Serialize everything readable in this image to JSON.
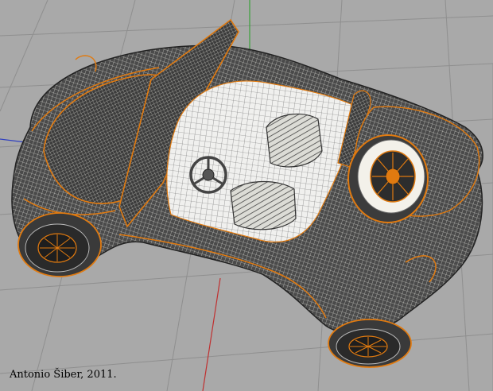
{
  "viewport": {
    "credit": "Antonio Šiber, 2011.",
    "background_color": "#a9a9a9",
    "grid_color": "#8f8f8f",
    "axes": [
      {
        "name": "x-axis",
        "color": "#c03030"
      },
      {
        "name": "y-axis",
        "color": "#3aa03a"
      },
      {
        "name": "z-axis",
        "color": "#3040c0"
      }
    ],
    "model": {
      "body_color": "#4a4a4a",
      "mesh_line_color": "#f2f2ea",
      "edge_highlight_color": "#e07a10",
      "interior_color": "#ececec"
    }
  }
}
